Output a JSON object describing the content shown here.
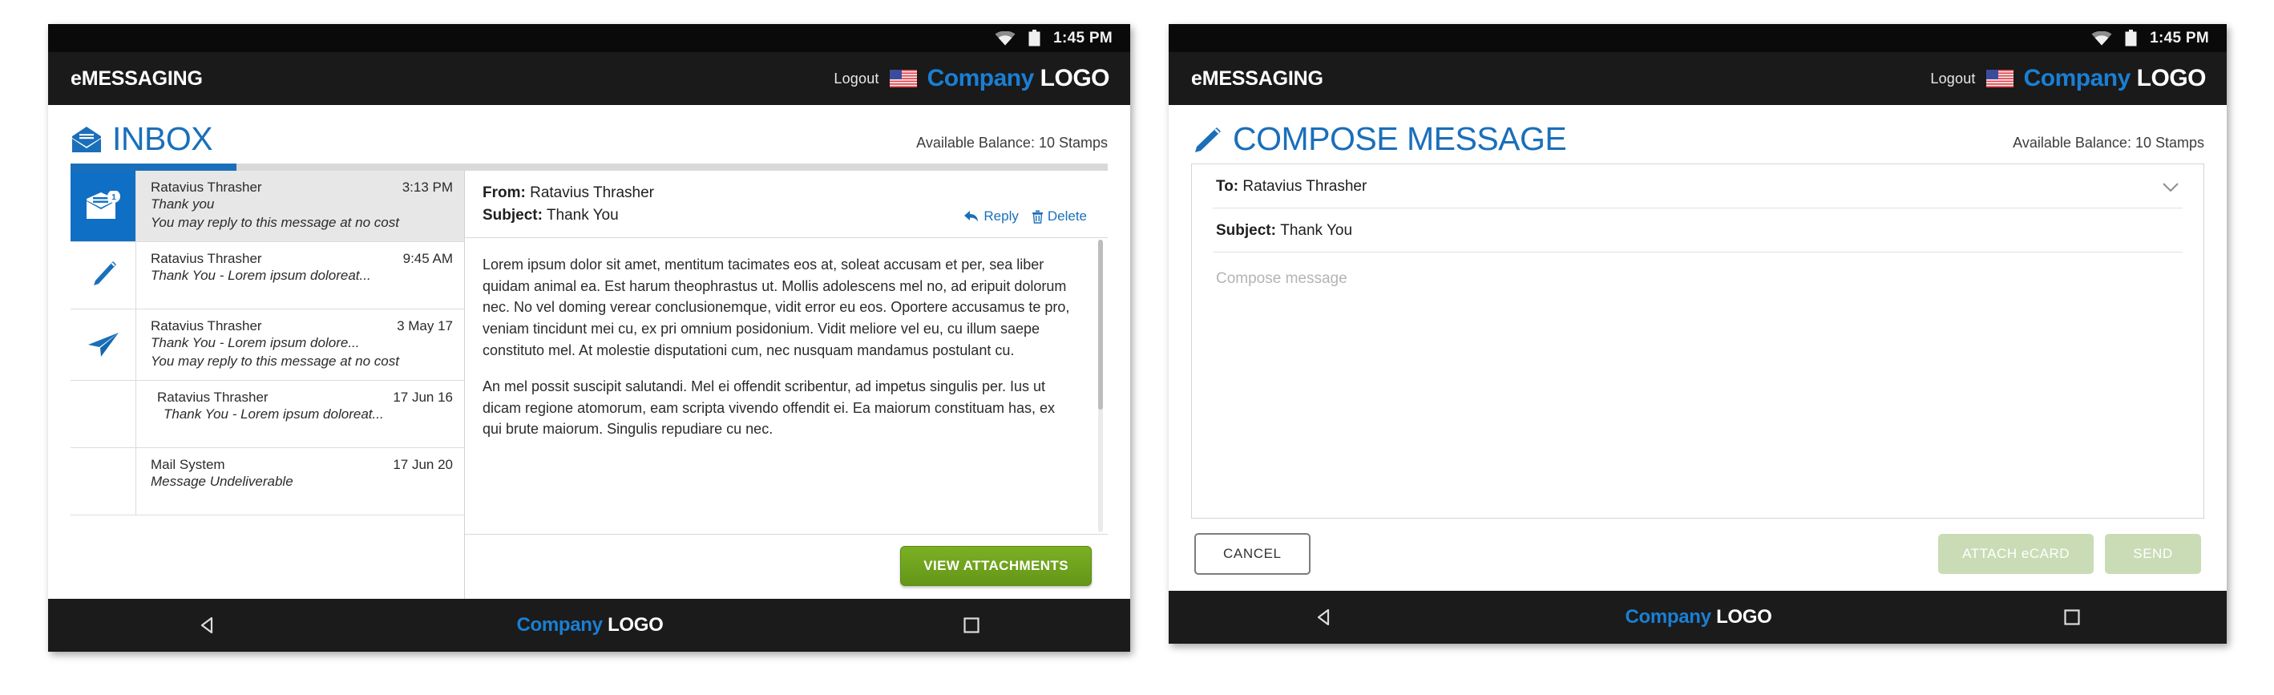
{
  "statusbar": {
    "time": "1:45 PM",
    "wifi_icon": "wifi-icon",
    "battery_icon": "battery-icon"
  },
  "header": {
    "app_name": "eMESSAGING",
    "logout_label": "Logout",
    "flag_icon": "us-flag-icon",
    "logo_primary": "Company",
    "logo_secondary": "LOGO",
    "logo_primary_color": "#1a7fd4"
  },
  "inbox": {
    "title": "INBOX",
    "title_icon": "open-envelope-icon",
    "balance": "Available Balance: 10 Stamps",
    "messages": [
      {
        "icon": "envelope-badge-icon",
        "from": "Ratavius Thrasher",
        "date": "3:13 PM",
        "subject": "Thank you",
        "note": "You may reply to this message at no cost"
      },
      {
        "icon": "pencil-icon",
        "from": "Ratavius Thrasher",
        "date": "9:45 AM",
        "subject": "Thank You - Lorem ipsum doloreat...",
        "note": ""
      },
      {
        "icon": "paper-plane-icon",
        "from": "Ratavius Thrasher",
        "date": "3 May 17",
        "subject": "Thank You - Lorem ipsum dolore...",
        "note": "You may reply to this message at no cost"
      },
      {
        "icon": "",
        "from": "Ratavius Thrasher",
        "date": "17 Jun 16",
        "subject": "Thank You - Lorem ipsum doloreat...",
        "note": ""
      },
      {
        "icon": "",
        "from": "Mail System",
        "date": "17 Jun 20",
        "subject": "Message Undeliverable",
        "note": ""
      }
    ],
    "reader": {
      "from_label": "From:",
      "from_value": "Ratavius Thrasher",
      "subject_label": "Subject:",
      "subject_value": "Thank You",
      "reply_label": "Reply",
      "reply_icon": "reply-arrow-icon",
      "delete_label": "Delete",
      "delete_icon": "trash-icon",
      "paragraph1": "Lorem ipsum dolor sit amet, mentitum tacimates eos at, soleat accusam et per, sea liber quidam animal ea. Est harum theophrastus ut. Mollis adolescens mel no, ad eripuit dolorum nec. No vel doming verear conclusionemque, vidit error eu eos. Oportere accusamus te pro, veniam tincidunt mei cu, ex pri omnium posidonium. Vidit meliore vel eu, cu illum saepe constituto mel. At molestie disputationi cum, nec nusquam mandamus postulant cu.",
      "paragraph2": "An mel possit suscipit salutandi. Mel ei offendit scribentur, ad impetus singulis per. Ius ut dicam regione atomorum, eam scripta vivendo offendit ei. Ea maiorum constituam has, ex qui brute maiorum. Singulis repudiare cu nec.",
      "attachments_button": "VIEW ATTACHMENTS",
      "attachments_button_color": "#6d9e1c"
    }
  },
  "compose": {
    "title": "COMPOSE MESSAGE",
    "title_icon": "pencil-icon",
    "balance": "Available Balance: 10 Stamps",
    "to_label": "To:",
    "to_value": "Ratavius Thrasher",
    "to_chevron_icon": "chevron-down-icon",
    "subject_label": "Subject:",
    "subject_value": "Thank You",
    "body_placeholder": "Compose message",
    "cancel_label": "CANCEL",
    "attach_label": "ATTACH eCARD",
    "send_label": "SEND",
    "disabled_button_color": "#cadcb6"
  },
  "navbar": {
    "back_icon": "back-triangle-icon",
    "logo_primary": "Company",
    "logo_secondary": "LOGO",
    "recents_icon": "square-icon"
  }
}
